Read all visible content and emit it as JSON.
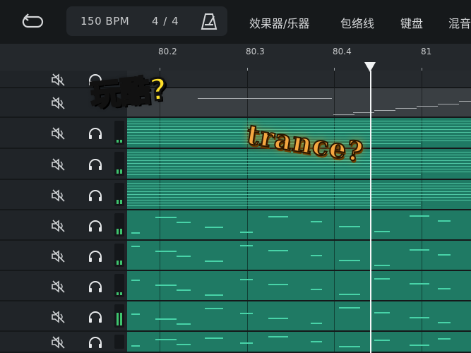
{
  "transport": {
    "bpm": "150 BPM",
    "time_signature": "4 / 4",
    "loop_icon": "loop-icon",
    "metronome_icon": "metronome-icon"
  },
  "menu": {
    "effects": "效果器/乐器",
    "envelope": "包络线",
    "keyboard": "键盘",
    "mix": "混音"
  },
  "ruler": {
    "labels": [
      "80.2",
      "80.3",
      "80.4",
      "81"
    ]
  },
  "tracks": {
    "mute_icon": "speaker-muted-icon",
    "solo_icon": "headphones-icon"
  },
  "overlay": {
    "caption_top": "玩酷?",
    "caption_mid": "trance?"
  },
  "colors": {
    "note_green": "#48d3a8",
    "lane_fill": "#1f7a64",
    "background": "#1f2327",
    "caption_yellow": "#ffe02a",
    "caption_orange": "#f4a640"
  }
}
